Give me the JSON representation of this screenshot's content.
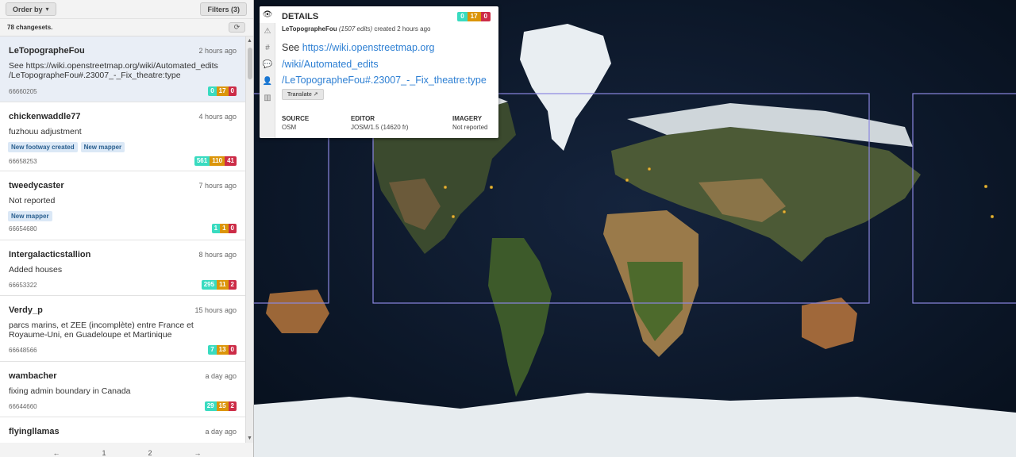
{
  "sidebar": {
    "order_by_label": "Order by",
    "filters_label": "Filters (3)",
    "count_label": "78 changesets.",
    "items": [
      {
        "user": "LeTopographeFou",
        "time": "2 hours ago",
        "comment": "See https://wiki.openstreetmap.org/wiki/Automated_edits/LeTopographeFou#.23007_-_Fix_theatre:type",
        "id": "66660205",
        "tags": [],
        "added": "0",
        "modified": "17",
        "deleted": "0"
      },
      {
        "user": "chickenwaddle77",
        "time": "4 hours ago",
        "comment": "fuzhouu adjustment",
        "id": "66658253",
        "tags": [
          "New footway created",
          "New mapper"
        ],
        "added": "561",
        "modified": "110",
        "deleted": "41"
      },
      {
        "user": "tweedycaster",
        "time": "7 hours ago",
        "comment": "Not reported",
        "id": "66654680",
        "tags": [
          "New mapper"
        ],
        "added": "1",
        "modified": "1",
        "deleted": "0"
      },
      {
        "user": "Intergalacticstallion",
        "time": "8 hours ago",
        "comment": "Added houses",
        "id": "66653322",
        "tags": [],
        "added": "295",
        "modified": "11",
        "deleted": "2"
      },
      {
        "user": "Verdy_p",
        "time": "15 hours ago",
        "comment": "parcs marins, et ZEE (incomplète) entre France et Royaume-Uni, en Guadeloupe et Martinique",
        "id": "66648566",
        "tags": [],
        "added": "7",
        "modified": "13",
        "deleted": "0"
      },
      {
        "user": "wambacher",
        "time": "a day ago",
        "comment": "fixing admin boundary in Canada",
        "id": "66644660",
        "tags": [],
        "added": "29",
        "modified": "15",
        "deleted": "2"
      },
      {
        "user": "flyingllamas",
        "time": "a day ago",
        "comment": "",
        "id": "",
        "tags": [],
        "added": "",
        "modified": "",
        "deleted": ""
      }
    ],
    "pager": {
      "prev": "←",
      "page1": "1",
      "page2": "2",
      "next": "→"
    }
  },
  "details": {
    "title": "DETAILS",
    "added": "0",
    "modified": "17",
    "deleted": "0",
    "user": "LeTopographeFou",
    "edits": "(1507 edits)",
    "created": "created 2 hours ago",
    "comment_prefix": "See",
    "comment_line1": "https://wiki.openstreetmap.org",
    "comment_line2": "/wiki/Automated_edits",
    "comment_line3": "/LeTopographeFou#.23007_-_Fix_theatre:type",
    "translate_label": "Translate",
    "source_label": "SOURCE",
    "source_value": "OSM",
    "editor_label": "EDITOR",
    "editor_value": "JOSM/1.5 (14620 fr)",
    "imagery_label": "IMAGERY",
    "imagery_value": "Not reported"
  },
  "colors": {
    "added": "#39dbc0",
    "modified": "#db950a",
    "deleted": "#cc2c47",
    "link": "#2d7fd3",
    "bbox": "#8a86e0"
  },
  "icons": [
    "eye-icon",
    "warning-icon",
    "hash-icon",
    "comment-icon",
    "user-icon",
    "list-icon",
    "refresh-icon",
    "external-link-icon"
  ]
}
